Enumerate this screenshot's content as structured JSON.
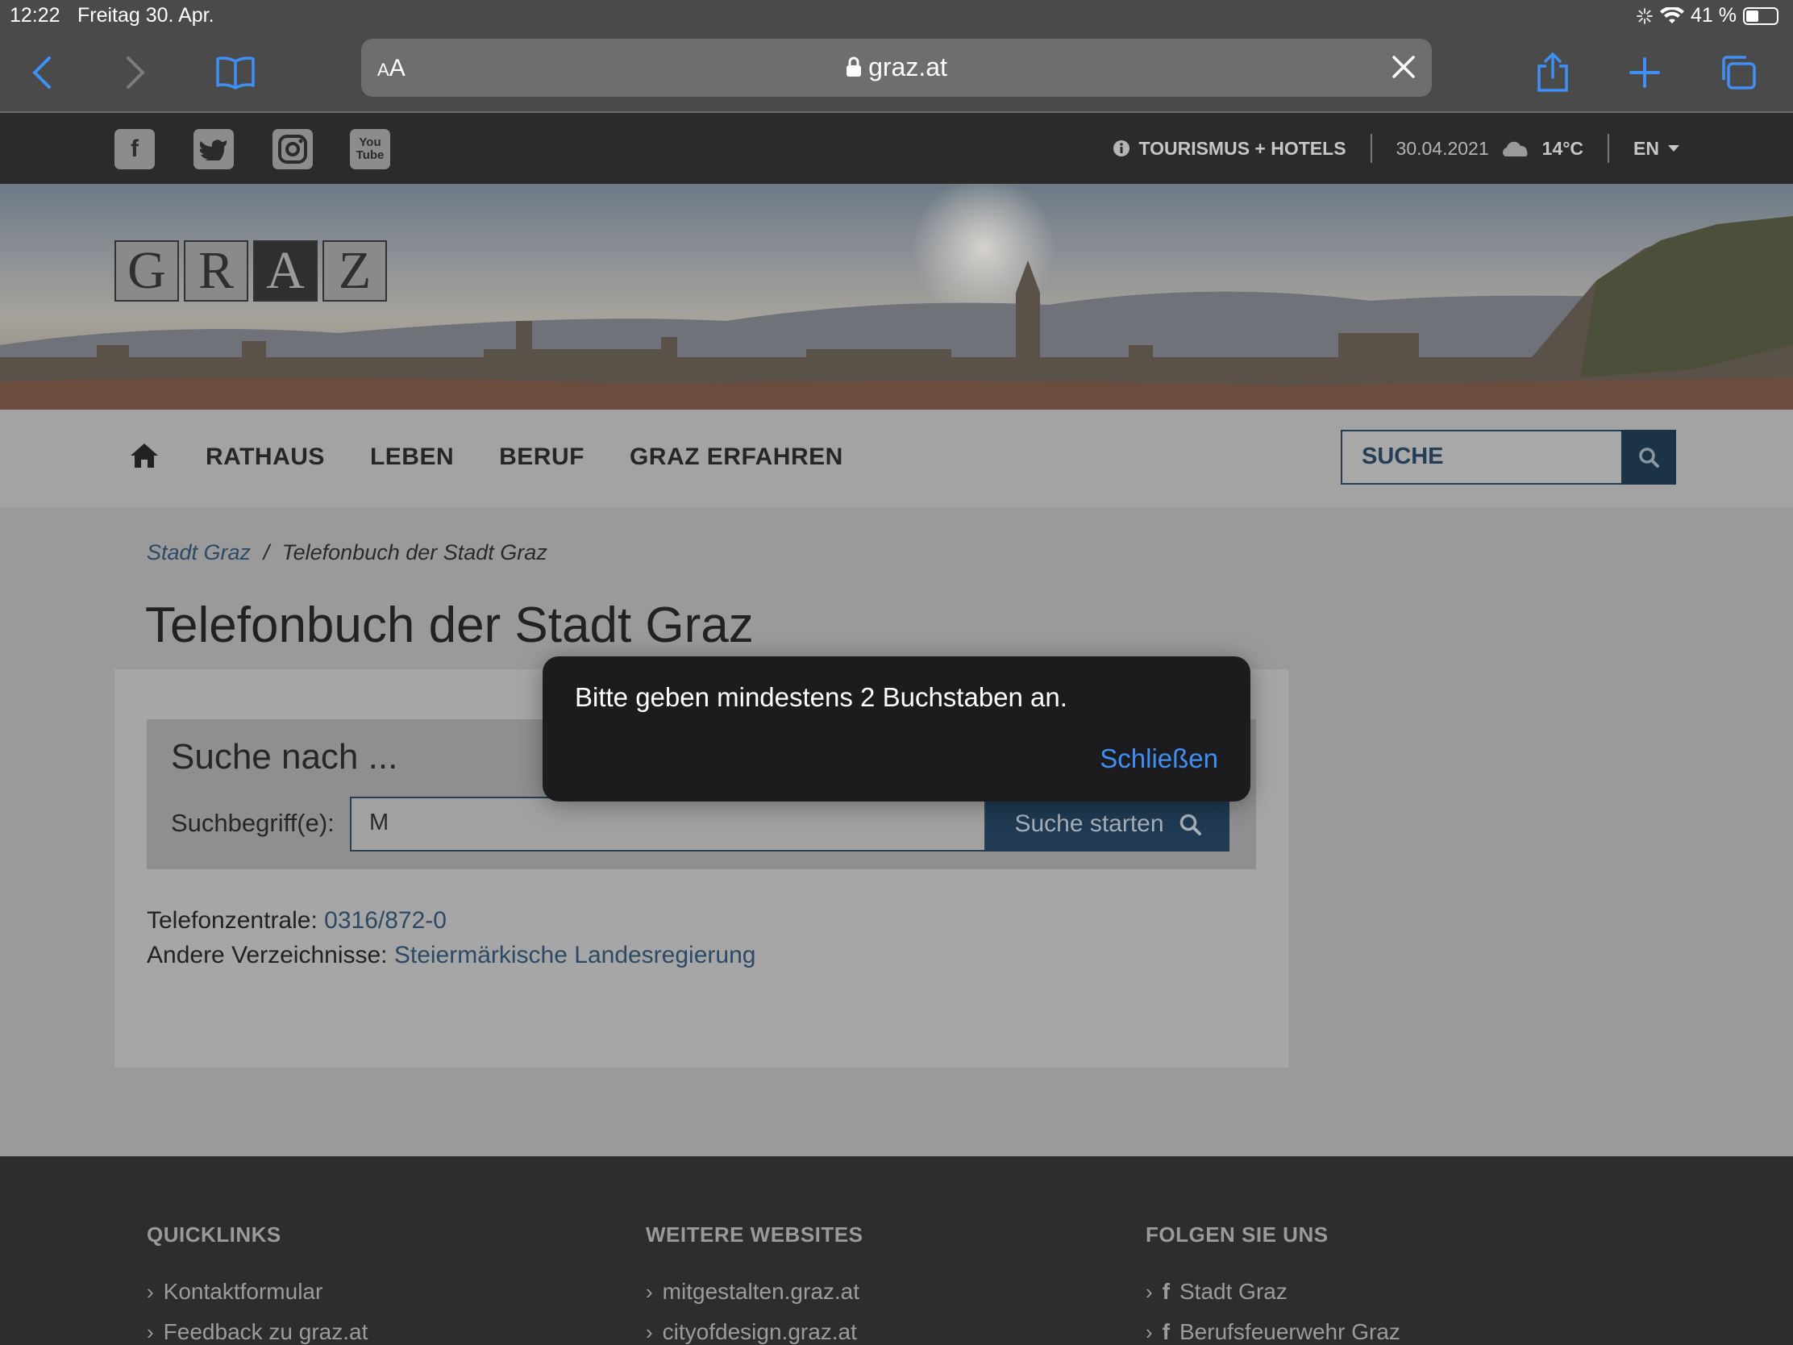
{
  "status_bar": {
    "time": "12:22",
    "date": "Freitag 30. Apr.",
    "battery": "41 %"
  },
  "browser": {
    "aa_small": "A",
    "aa_large": "A",
    "url": "graz.at"
  },
  "topbar": {
    "tourism": "TOURISMUS + HOTELS",
    "date": "30.04.2021",
    "temperature": "14°C",
    "language": "EN",
    "social": [
      "facebook",
      "twitter",
      "instagram",
      "youtube"
    ]
  },
  "banner": {
    "logo_letters": [
      "G",
      "R",
      "A",
      "Z"
    ]
  },
  "nav": {
    "items": [
      "RATHAUS",
      "LEBEN",
      "BERUF",
      "GRAZ ERFAHREN"
    ],
    "search_placeholder": "SUCHE"
  },
  "breadcrumb": {
    "home": "Stadt Graz",
    "separator": "/",
    "current": "Telefonbuch der Stadt Graz"
  },
  "page_title": "Telefonbuch der Stadt Graz",
  "search": {
    "heading": "Suche nach ...",
    "label": "Suchbegriff(e):",
    "value": "M",
    "button": "Suche starten"
  },
  "info": {
    "switchboard_label": "Telefonzentrale:",
    "switchboard_number": "0316/872-0",
    "other_label": "Andere Verzeichnisse:",
    "other_link": "Steiermärkische Landesregierung"
  },
  "footer": {
    "quicklinks": {
      "title": "QUICKLINKS",
      "items": [
        "Kontaktformular",
        "Feedback zu graz.at"
      ]
    },
    "websites": {
      "title": "WEITERE WEBSITES",
      "items": [
        "mitgestalten.graz.at",
        "cityofdesign.graz.at"
      ]
    },
    "follow": {
      "title": "FOLGEN SIE UNS",
      "items": [
        "Stadt Graz",
        "Berufsfeuerwehr Graz"
      ]
    }
  },
  "dialog": {
    "message": "Bitte geben mindestens 2 Buchstaben an.",
    "close": "Schließen"
  },
  "colors": {
    "accent": "#3f8ff5",
    "nav_dark": "#1c3347",
    "link": "#2c4a66"
  }
}
